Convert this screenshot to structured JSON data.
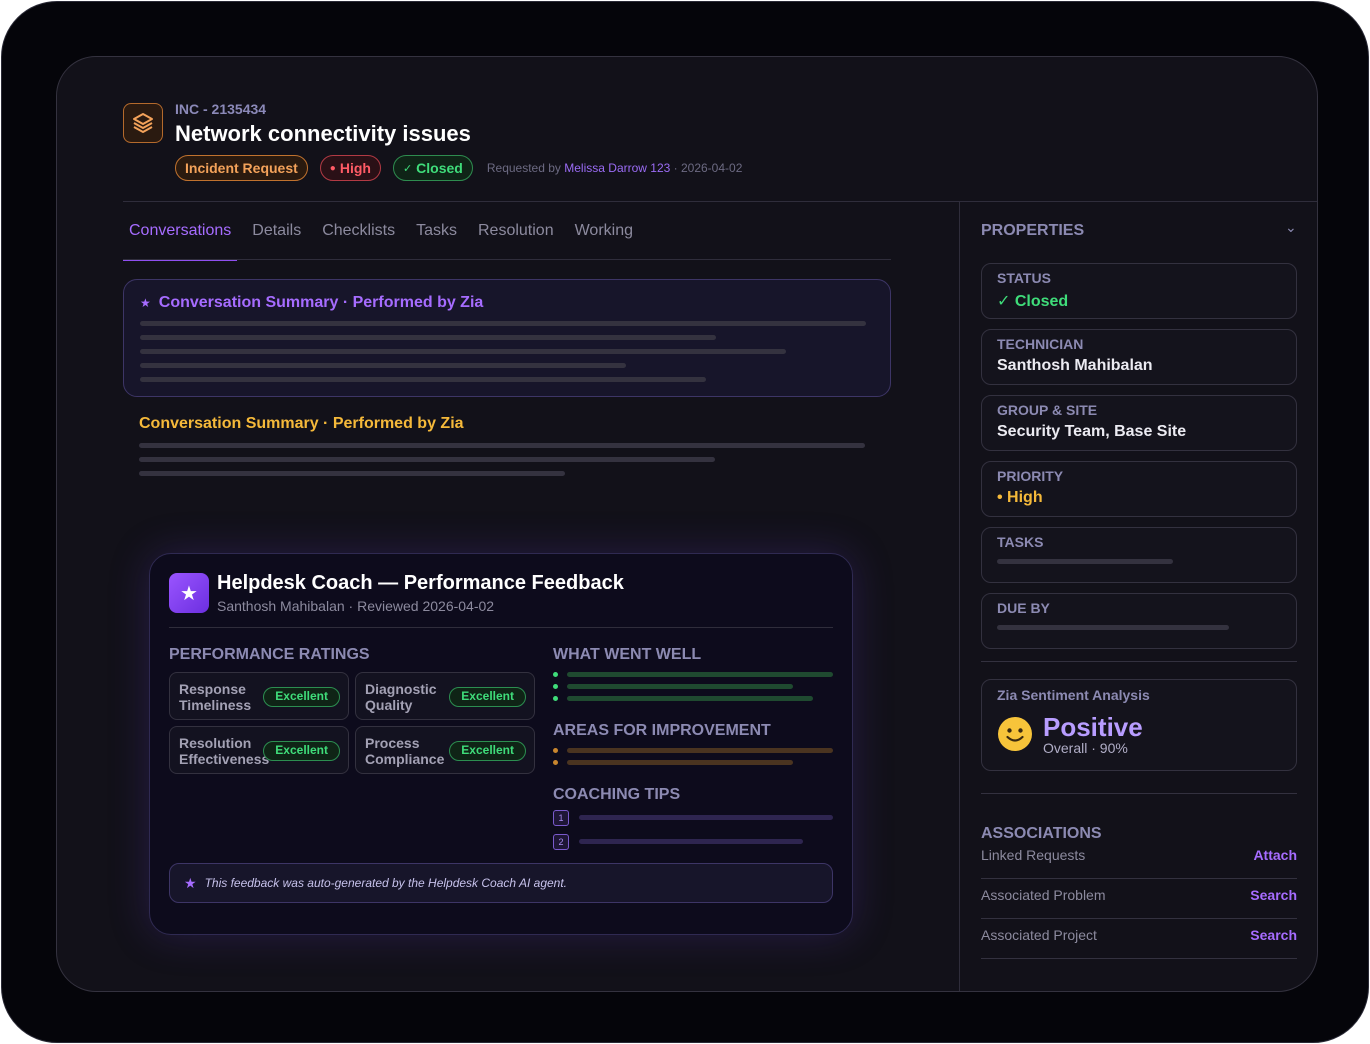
{
  "incident": {
    "id": "INC - 2135434",
    "title": "Network connectivity issues",
    "type_badge": "Incident Request",
    "priority_badge": "High",
    "status_badge": "Closed",
    "requested_by_prefix": "Requested by",
    "requested_by": "Melissa Darrow 123",
    "requested_date": "· 2026-04-02"
  },
  "tabs": [
    {
      "label": "Conversations",
      "active": true
    },
    {
      "label": "Details"
    },
    {
      "label": "Checklists"
    },
    {
      "label": "Tasks"
    },
    {
      "label": "Resolution"
    },
    {
      "label": "Working"
    }
  ],
  "summary_1": {
    "star": "★",
    "title": "Conversation Summary · Performed by Zia"
  },
  "summary_2": {
    "title": "Conversation Summary · Performed by Zia"
  },
  "coach": {
    "icon": "★",
    "title": "Helpdesk Coach — Performance Feedback",
    "subtitle": "Santhosh Mahibalan · Reviewed 2026-04-02",
    "ratings_heading": "PERFORMANCE RATINGS",
    "ratings": [
      {
        "label": "Response Timeliness",
        "value": "Excellent"
      },
      {
        "label": "Diagnostic Quality",
        "value": "Excellent"
      },
      {
        "label": "Resolution Effectiveness",
        "value": "Excellent"
      },
      {
        "label": "Process Compliance",
        "value": "Excellent"
      }
    ],
    "went_well_heading": "WHAT WENT WELL",
    "improvement_heading": "AREAS FOR IMPROVEMENT",
    "tips_heading": "COACHING TIPS",
    "tips_numbers": [
      "1",
      "2"
    ],
    "footnote": "This feedback was auto-generated by the Helpdesk Coach AI agent.",
    "footnote_star": "★"
  },
  "properties": {
    "heading": "PROPERTIES",
    "chevron": "⌄",
    "status_label": "STATUS",
    "status_value": "✓ Closed",
    "technician_label": "TECHNICIAN",
    "technician_value": "Santhosh Mahibalan",
    "group_label": "GROUP & SITE",
    "group_value": "Security Team, Base Site",
    "priority_label": "PRIORITY",
    "priority_value": "• High",
    "tasks_label": "TASKS",
    "due_label": "DUE BY"
  },
  "zia": {
    "label": "Zia Sentiment Analysis",
    "sentiment": "Positive",
    "overall": "Overall · 90%"
  },
  "associations": {
    "heading": "ASSOCIATIONS",
    "rows": [
      {
        "name": "Linked Requests",
        "action": "Attach"
      },
      {
        "name": "Associated Problem",
        "action": "Search"
      },
      {
        "name": "Associated Project",
        "action": "Search"
      }
    ]
  },
  "colors": {
    "accent": "#a66cff",
    "success": "#3fdc7a",
    "warning": "#f5b93a",
    "danger": "#ff5b66",
    "orange": "#f3a25a"
  }
}
